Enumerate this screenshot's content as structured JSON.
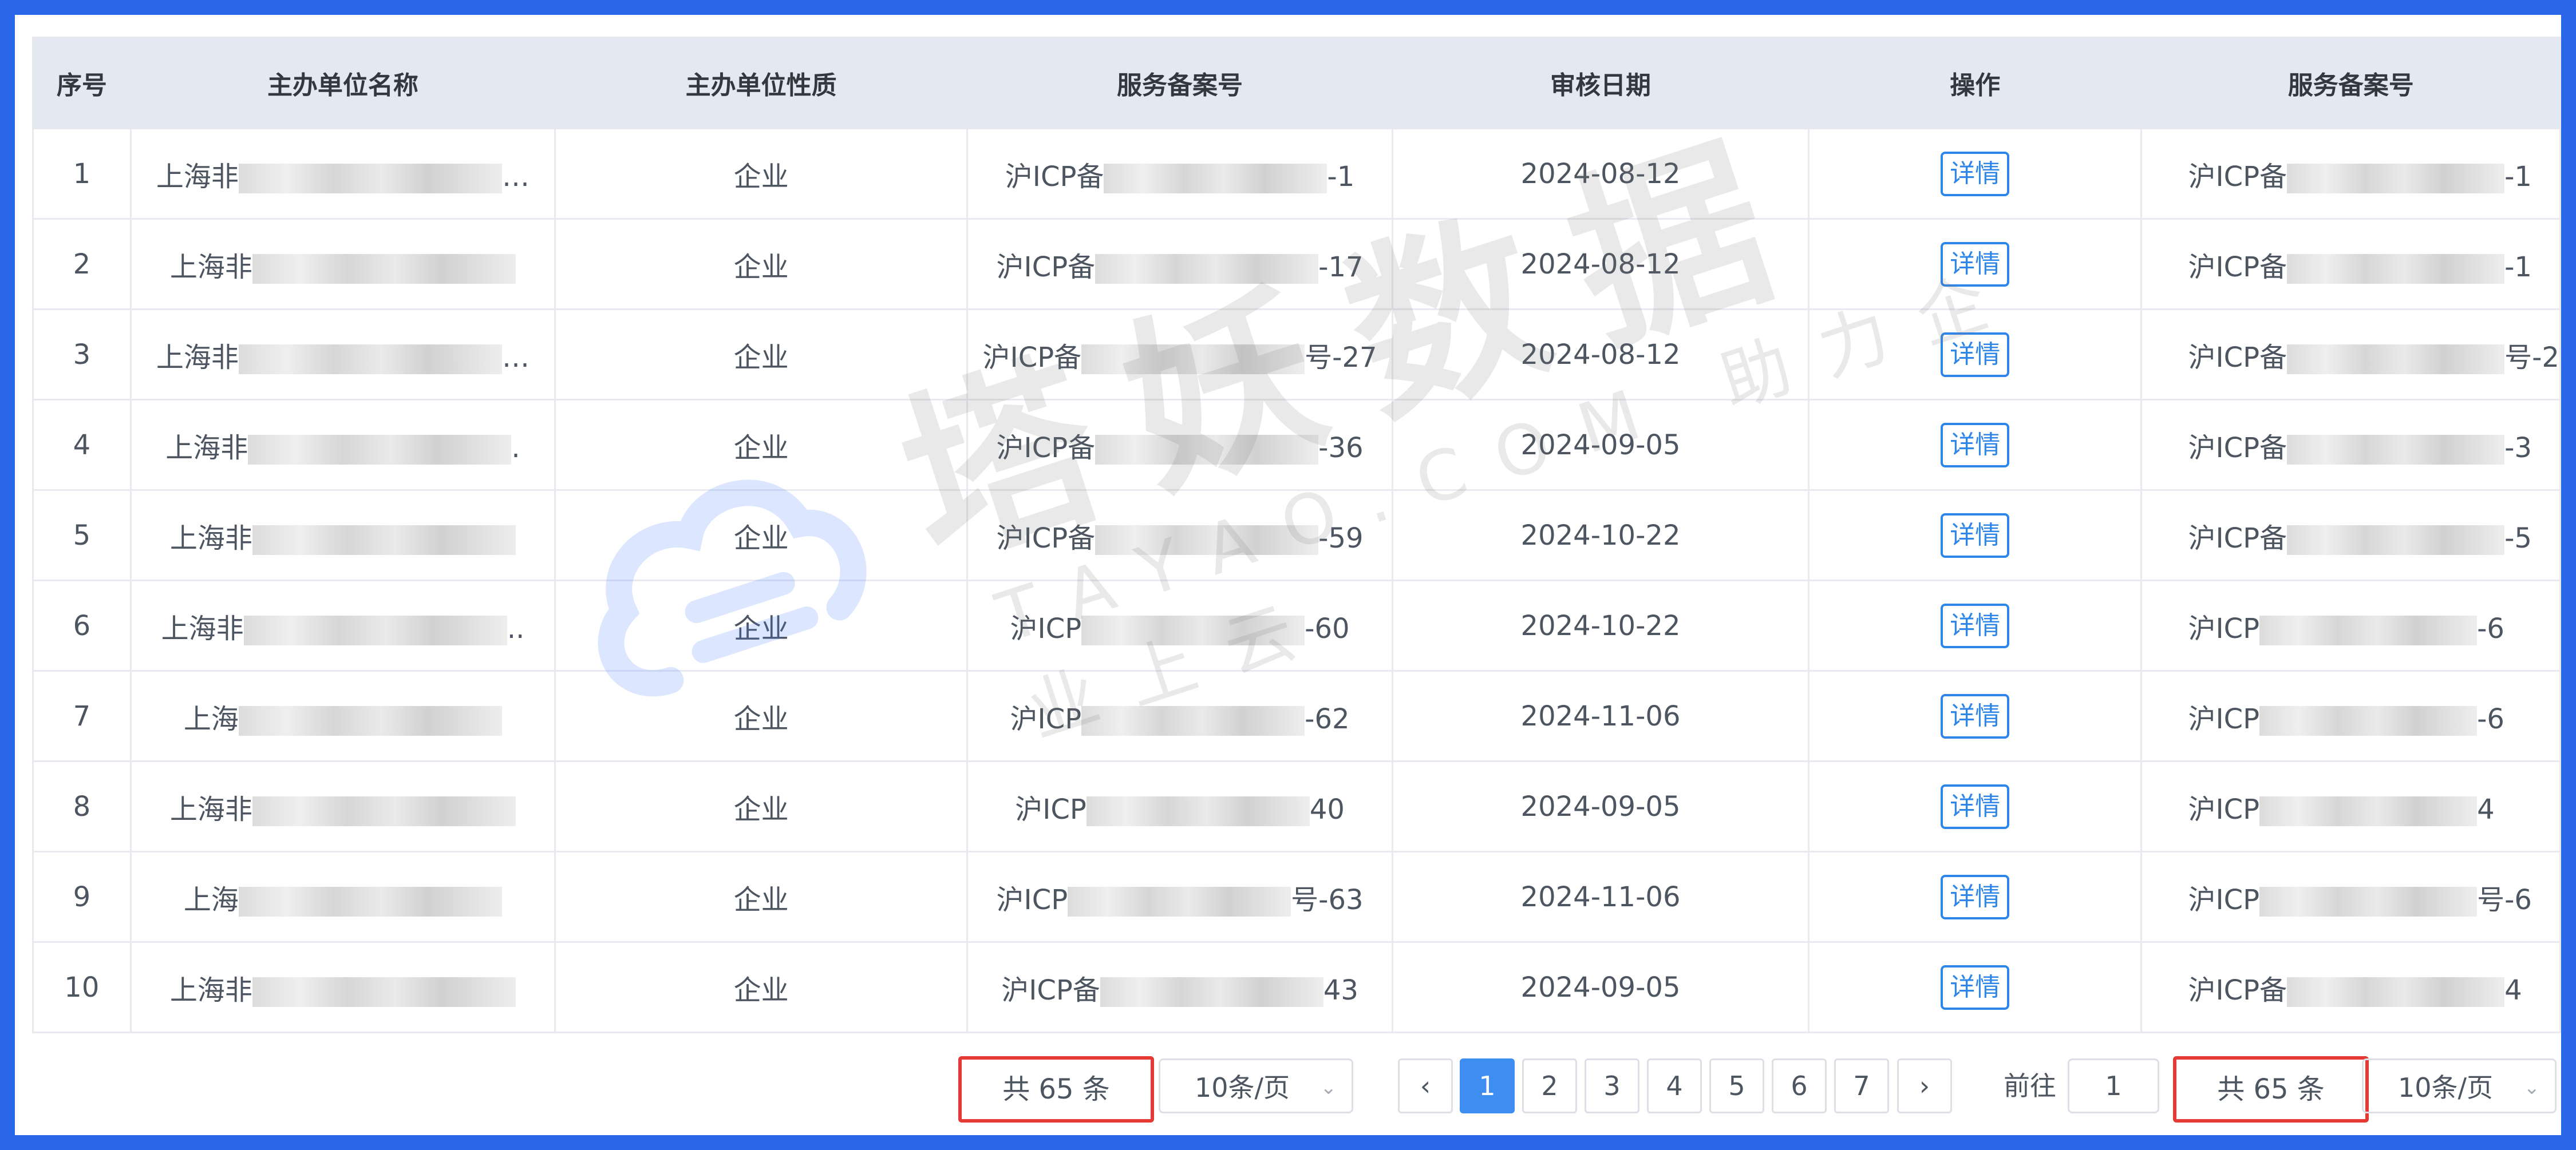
{
  "table": {
    "headers": [
      "序号",
      "主办单位名称",
      "主办单位性质",
      "服务备案号",
      "审核日期",
      "操作",
      "服务备案号"
    ],
    "rows": [
      {
        "no": "1",
        "name_pre": "上海非",
        "name_suf": "…",
        "nature": "企业",
        "icp_pre": "沪ICP备",
        "icp_suf": "-1",
        "date": "2024-08-12",
        "action": "详情",
        "icp2_pre": "沪ICP备",
        "icp2_suf": "-1"
      },
      {
        "no": "2",
        "name_pre": "上海非",
        "name_suf": "",
        "nature": "企业",
        "icp_pre": "沪ICP备",
        "icp_suf": "-17",
        "date": "2024-08-12",
        "action": "详情",
        "icp2_pre": "沪ICP备",
        "icp2_suf": "-1"
      },
      {
        "no": "3",
        "name_pre": "上海非",
        "name_suf": "…",
        "nature": "企业",
        "icp_pre": "沪ICP备",
        "icp_suf": "号-27",
        "date": "2024-08-12",
        "action": "详情",
        "icp2_pre": "沪ICP备",
        "icp2_suf": "号-2"
      },
      {
        "no": "4",
        "name_pre": "上海非",
        "name_suf": ".",
        "nature": "企业",
        "icp_pre": "沪ICP备",
        "icp_suf": "-36",
        "date": "2024-09-05",
        "action": "详情",
        "icp2_pre": "沪ICP备",
        "icp2_suf": "-3"
      },
      {
        "no": "5",
        "name_pre": "上海非",
        "name_suf": "",
        "nature": "企业",
        "icp_pre": "沪ICP备",
        "icp_suf": "-59",
        "date": "2024-10-22",
        "action": "详情",
        "icp2_pre": "沪ICP备",
        "icp2_suf": "-5"
      },
      {
        "no": "6",
        "name_pre": "上海非",
        "name_suf": "..",
        "nature": "企业",
        "icp_pre": "沪ICP",
        "icp_suf": "-60",
        "date": "2024-10-22",
        "action": "详情",
        "icp2_pre": "沪ICP",
        "icp2_suf": "-6"
      },
      {
        "no": "7",
        "name_pre": "上海",
        "name_suf": "",
        "nature": "企业",
        "icp_pre": "沪ICP",
        "icp_suf": "-62",
        "date": "2024-11-06",
        "action": "详情",
        "icp2_pre": "沪ICP",
        "icp2_suf": "-6"
      },
      {
        "no": "8",
        "name_pre": "上海非",
        "name_suf": "",
        "nature": "企业",
        "icp_pre": "沪ICP",
        "icp_suf": "40",
        "date": "2024-09-05",
        "action": "详情",
        "icp2_pre": "沪ICP",
        "icp2_suf": "4"
      },
      {
        "no": "9",
        "name_pre": "上海",
        "name_suf": "",
        "nature": "企业",
        "icp_pre": "沪ICP",
        "icp_suf": "号-63",
        "date": "2024-11-06",
        "action": "详情",
        "icp2_pre": "沪ICP",
        "icp2_suf": "号-6"
      },
      {
        "no": "10",
        "name_pre": "上海非",
        "name_suf": "",
        "nature": "企业",
        "icp_pre": "沪ICP备",
        "icp_suf": "43",
        "date": "2024-09-05",
        "action": "详情",
        "icp2_pre": "沪ICP备",
        "icp2_suf": "4"
      }
    ]
  },
  "pagination": {
    "total": "共 65 条",
    "page_size": "10条/页",
    "prev": "‹",
    "next": "›",
    "pages": [
      "1",
      "2",
      "3",
      "4",
      "5",
      "6",
      "7"
    ],
    "active_page": "1",
    "goto_label": "前往",
    "goto_value": "1",
    "total_2": "共 65 条",
    "page_size_2": "10条/页"
  },
  "watermark": {
    "main": "塔妖数据",
    "sub": "TAYAO.COM 助力企业上云",
    "color": "#787878"
  },
  "colors": {
    "frame": "#2966e8",
    "header_bg": "#e4e8f2",
    "link": "#2f86e9",
    "active_page": "#3d8ef0",
    "highlight_border": "#e53935"
  }
}
